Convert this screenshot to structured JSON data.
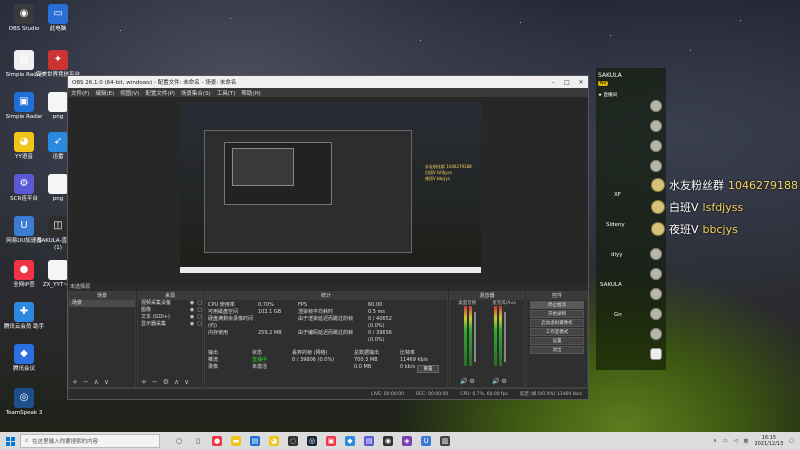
{
  "desktop_icons": [
    {
      "label": "OBS Studio",
      "color": "#3a3a3a",
      "glyph": "◉"
    },
    {
      "label": "此电脑",
      "color": "#2a6fd8",
      "glyph": "▭"
    },
    {
      "label": "Simple Radar",
      "color": "#f0f0f0",
      "glyph": "▤"
    },
    {
      "label": "完美世界竞技平台",
      "color": "#c33",
      "glyph": "✦"
    },
    {
      "label": "Simple Radar",
      "color": "#1e6fd8",
      "glyph": "▣"
    },
    {
      "label": "png",
      "color": "#f5f5f5",
      "glyph": ""
    },
    {
      "label": "YY语音",
      "color": "#f0c419",
      "glyph": "◕"
    },
    {
      "label": "迅雷",
      "color": "#2a8ae2",
      "glyph": "➶"
    },
    {
      "label": "SCR连平台",
      "color": "#5a5ad8",
      "glyph": "⚙"
    },
    {
      "label": "png",
      "color": "#f5f5f5",
      "glyph": ""
    },
    {
      "label": "网易UU加速器",
      "color": "#3b7bd4",
      "glyph": "U"
    },
    {
      "label": "SAKULA-直播间(1)",
      "color": "#2d2d2d",
      "glyph": "◫"
    },
    {
      "label": "全网IP查",
      "color": "#e34",
      "glyph": "●"
    },
    {
      "label": "ZX_YYT~...",
      "color": "#f5f5f5",
      "glyph": ""
    },
    {
      "label": "腾讯云会员 助手",
      "color": "#2a8ae2",
      "glyph": "✚"
    },
    {
      "label": "腾讯会议",
      "color": "#2b6fe0",
      "glyph": "◆"
    },
    {
      "label": "TeamSpeak 3",
      "color": "#1f4e8c",
      "glyph": "◎"
    }
  ],
  "obs": {
    "title": "OBS 26.1.0 (64-bit, windows) - 配置文件: 未命名 - 场景: 未命名",
    "menu": [
      "文件(F)",
      "编辑(E)",
      "视图(V)",
      "配置文件(P)",
      "场景集合(S)",
      "工具(T)",
      "帮助(H)"
    ],
    "scene_bar_label": "未选择源",
    "scenes": {
      "header": "场景",
      "items": [
        "场景"
      ]
    },
    "sources": {
      "header": "来源",
      "items": [
        "视频采集设备",
        "图像",
        "文本 (GDI+)",
        "显示器采集"
      ]
    },
    "stats": {
      "header": "统计",
      "rows": [
        [
          "CPU 使用率",
          "0.70%",
          "FPS",
          "60.00"
        ],
        [
          "可用磁盘空间",
          "102.1 GB",
          "渲染帧平均耗时",
          "0.5 ms"
        ],
        [
          "硬盘满剩余录像时间 (约)",
          "",
          "由于渲染延迟而跳过的帧",
          "0 / 40652 (0.0%)"
        ],
        [
          "内存使用",
          "259.2 MB",
          "由于编码延迟而跳过的帧",
          "0 / 39656 (0.0%)"
        ]
      ],
      "table_headers": [
        "输出",
        "状态",
        "丢弃的帧 (网络)",
        "总数据输出",
        "比特率"
      ],
      "table_rows": [
        [
          "推流",
          "直播中",
          "0 / 39806 (0.0%)",
          "700.3 MB",
          "11469 kb/s"
        ],
        [
          "录像",
          "未激活",
          "",
          "0.0 MB",
          "0 kb/s"
        ]
      ],
      "reset_label": "重置"
    },
    "mixer": {
      "header": "混音器",
      "channels": [
        "桌面音频",
        "麦克风/Aux"
      ]
    },
    "controls": {
      "header": "控件",
      "buttons": [
        "停止推流",
        "开始录制",
        "启动虚拟摄像机",
        "工作室模式",
        "设置",
        "退出"
      ]
    },
    "status": {
      "live": "LIVE: 00:00:00",
      "rec": "REC: 00:00:00",
      "cpu": "CPU: 0.7%, 60.00 fps",
      "dropped": "延迟 (帧 0/0.0%) 11469 kb/s"
    }
  },
  "preview": {
    "chat_lines": [
      "水友粉丝群 1046279188",
      "白班V lsfdjyss",
      "夜班V bbcjys"
    ]
  },
  "side_panel": {
    "user": "SAKULA",
    "level": "NV",
    "subtitle": "★ 直播间",
    "names": [
      "XF",
      "Sldeny",
      "diyy",
      "SAKULA",
      "Gn"
    ]
  },
  "chat": [
    {
      "user": "水友粉丝群",
      "msg": "1046279188"
    },
    {
      "user": "白班V",
      "msg": "lsfdjyss"
    },
    {
      "user": "夜班V",
      "msg": "bbcjys"
    }
  ],
  "taskbar": {
    "search_placeholder": "在这里输入你要搜索的内容",
    "time": "16:15",
    "date": "2021/12/13",
    "ime": "英"
  }
}
